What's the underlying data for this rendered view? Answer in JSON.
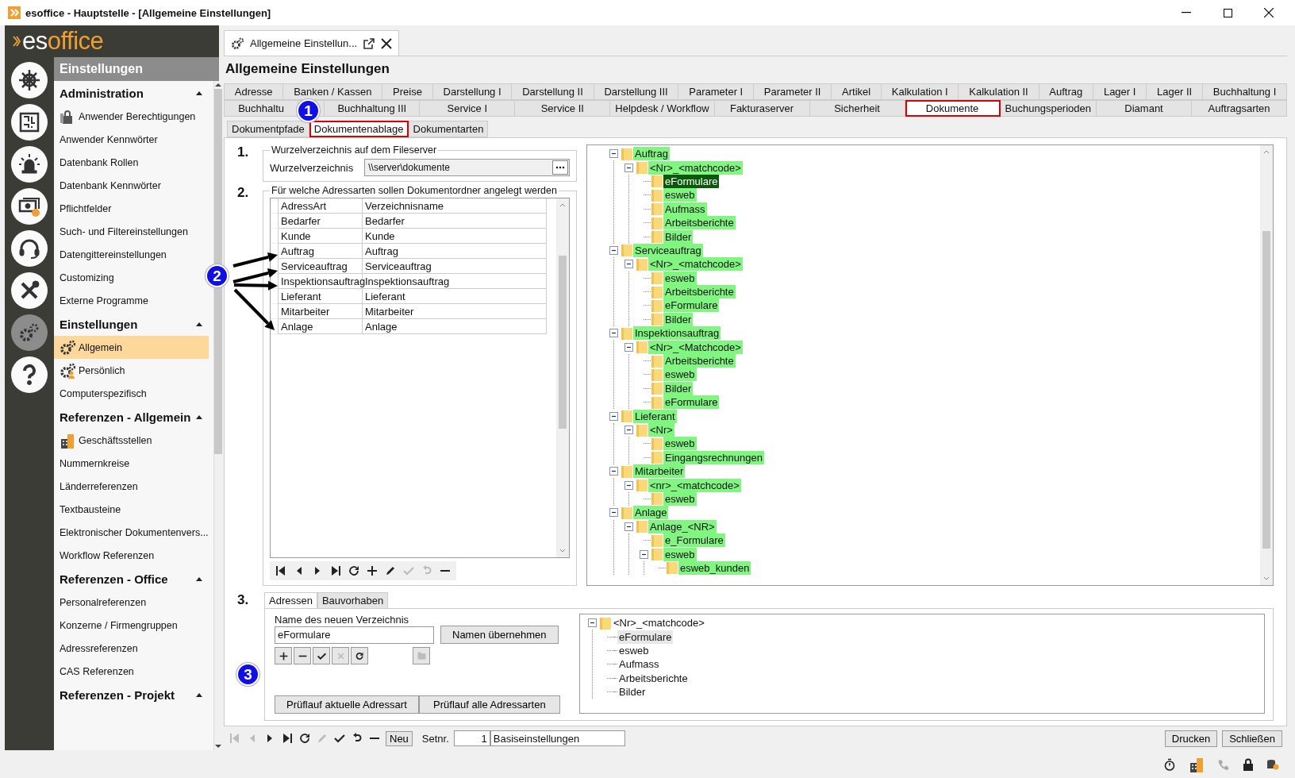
{
  "window": {
    "title": "esoffice - Hauptstelle - [Allgemeine Einstellungen]"
  },
  "logo": {
    "prefix": "es",
    "suffix": "office"
  },
  "rail": [
    {
      "kind": "helm",
      "selected": false
    },
    {
      "kind": "board",
      "selected": false
    },
    {
      "kind": "siren",
      "selected": false
    },
    {
      "kind": "money",
      "selected": false
    },
    {
      "kind": "headset",
      "selected": false
    },
    {
      "kind": "tools",
      "selected": false
    },
    {
      "kind": "gears",
      "selected": true
    },
    {
      "kind": "help",
      "selected": false
    }
  ],
  "sidebar": {
    "title": "Einstellungen",
    "sections": [
      {
        "title": "Administration",
        "expanded": true,
        "items": [
          {
            "label": "Anwender Berechtigungen",
            "kind": "lock",
            "selected": false
          },
          {
            "label": "Anwender Kennwörter",
            "kind": "plain",
            "selected": false
          },
          {
            "label": "Datenbank Rollen",
            "kind": "plain",
            "selected": false
          },
          {
            "label": "Datenbank Kennwörter",
            "kind": "plain",
            "selected": false
          },
          {
            "label": "Pflichtfelder",
            "kind": "plain",
            "selected": false
          },
          {
            "label": "Such- und Filtereinstellungen",
            "kind": "plain",
            "selected": false
          },
          {
            "label": "Datengittereinstellungen",
            "kind": "plain",
            "selected": false
          },
          {
            "label": "Customizing",
            "kind": "plain",
            "selected": false
          },
          {
            "label": "Externe Programme",
            "kind": "plain",
            "selected": false
          }
        ]
      },
      {
        "title": "Einstellungen",
        "expanded": true,
        "items": [
          {
            "label": "Allgemein",
            "kind": "gears",
            "selected": true
          },
          {
            "label": "Persönlich",
            "kind": "gear-person",
            "selected": false
          },
          {
            "label": "Computerspezifisch",
            "kind": "plain",
            "selected": false
          }
        ]
      },
      {
        "title": "Referenzen - Allgemein",
        "expanded": true,
        "items": [
          {
            "label": "Geschäftsstellen",
            "kind": "building",
            "selected": false
          },
          {
            "label": "Nummernkreise",
            "kind": "plain",
            "selected": false
          },
          {
            "label": "Länderreferenzen",
            "kind": "plain",
            "selected": false
          },
          {
            "label": "Textbausteine",
            "kind": "plain",
            "selected": false
          },
          {
            "label": "Elektronischer Dokumentenvers...",
            "kind": "plain",
            "selected": false
          },
          {
            "label": "Workflow Referenzen",
            "kind": "plain",
            "selected": false
          }
        ]
      },
      {
        "title": "Referenzen - Office",
        "expanded": true,
        "items": [
          {
            "label": "Personalreferenzen",
            "kind": "plain",
            "selected": false
          },
          {
            "label": "Konzerne / Firmengruppen",
            "kind": "plain",
            "selected": false
          },
          {
            "label": "Adressreferenzen",
            "kind": "plain",
            "selected": false
          },
          {
            "label": "CAS Referenzen",
            "kind": "plain",
            "selected": false
          }
        ]
      },
      {
        "title": "Referenzen - Projekt",
        "expanded": true
      }
    ]
  },
  "document_tab": {
    "title": "Allgemeine Einstellun..."
  },
  "page_title": "Allgemeine Einstellungen",
  "tab_rows": [
    [
      {
        "label": "Adresse",
        "selected": false,
        "marked": false
      },
      {
        "label": "Banken / Kassen",
        "selected": false,
        "marked": false
      },
      {
        "label": "Preise",
        "selected": false,
        "marked": false
      },
      {
        "label": "Darstellung I",
        "selected": false,
        "marked": false
      },
      {
        "label": "Darstellung II",
        "selected": false,
        "marked": false
      },
      {
        "label": "Darstellung III",
        "selected": false,
        "marked": false
      },
      {
        "label": "Parameter I",
        "selected": false,
        "marked": false
      },
      {
        "label": "Parameter II",
        "selected": false,
        "marked": false
      },
      {
        "label": "Artikel",
        "selected": false,
        "marked": false
      },
      {
        "label": "Kalkulation I",
        "selected": false,
        "marked": false
      },
      {
        "label": "Kalkulation II",
        "selected": false,
        "marked": false
      },
      {
        "label": "Auftrag",
        "selected": false,
        "marked": false
      },
      {
        "label": "Lager I",
        "selected": false,
        "marked": false
      },
      {
        "label": "Lager II",
        "selected": false,
        "marked": false
      },
      {
        "label": "Buchhaltung I",
        "selected": false,
        "marked": false
      }
    ],
    [
      {
        "label": "Buchhaltu",
        "selected": false,
        "marked": false
      },
      {
        "label": "Buchhaltung III",
        "selected": false,
        "marked": false
      },
      {
        "label": "Service I",
        "selected": false,
        "marked": false
      },
      {
        "label": "Service II",
        "selected": false,
        "marked": false
      },
      {
        "label": "Helpdesk / Workflow",
        "selected": false,
        "marked": false
      },
      {
        "label": "Fakturaserver",
        "selected": false,
        "marked": false
      },
      {
        "label": "Sicherheit",
        "selected": false,
        "marked": false
      },
      {
        "label": "Dokumente",
        "selected": true,
        "marked": true
      },
      {
        "label": "Buchungsperioden",
        "selected": false,
        "marked": false
      },
      {
        "label": "Diamant",
        "selected": false,
        "marked": false
      },
      {
        "label": "Auftragsarten",
        "selected": false,
        "marked": false
      }
    ]
  ],
  "subtabs": [
    {
      "label": "Dokumentpfade",
      "selected": false,
      "marked": false
    },
    {
      "label": "Dokumentenablage",
      "selected": true,
      "marked": true
    },
    {
      "label": "Dokumentarten",
      "selected": false,
      "marked": false
    }
  ],
  "root_dir": {
    "number": "1.",
    "legend": "Wurzelverzeichnis auf dem Fileserver",
    "label": "Wurzelverzeichnis",
    "value": "\\\\server\\dokumente"
  },
  "address_types": {
    "number": "2.",
    "legend": "Für welche Adressarten sollen Dokumentordner angelegt werden",
    "columns": [
      "AdressArt",
      "Verzeichnisname"
    ],
    "rows": [
      [
        "Bedarfer",
        "Bedarfer"
      ],
      [
        "Kunde",
        "Kunde"
      ],
      [
        "Auftrag",
        "Auftrag"
      ],
      [
        "Serviceauftrag",
        "Serviceauftrag"
      ],
      [
        "Inspektionsauftrag",
        "Inspektionsauftrag"
      ],
      [
        "Lieferant",
        "Lieferant"
      ],
      [
        "Mitarbeiter",
        "Mitarbeiter"
      ],
      [
        "Anlage",
        "Anlage"
      ]
    ],
    "tools": [
      {
        "kind": "first",
        "disabled": false
      },
      {
        "kind": "prev",
        "disabled": false
      },
      {
        "kind": "next",
        "disabled": false
      },
      {
        "kind": "last",
        "disabled": false
      },
      {
        "kind": "refresh",
        "disabled": false
      },
      {
        "kind": "add",
        "disabled": false
      },
      {
        "kind": "edit",
        "disabled": false
      },
      {
        "kind": "confirm",
        "disabled": true
      },
      {
        "kind": "undo",
        "disabled": true
      },
      {
        "kind": "delete",
        "disabled": false
      }
    ]
  },
  "folder_tree": {
    "highlighted": true,
    "all_folders": true,
    "nodes": [
      {
        "label": "Auftrag",
        "selected": false,
        "expanded": true,
        "children": [
          {
            "label": "<Nr>_<matchcode>",
            "selected": false,
            "expanded": true,
            "children": [
              {
                "label": "eFormulare",
                "selected": true
              },
              {
                "label": "esweb",
                "selected": false
              },
              {
                "label": "Aufmass",
                "selected": false
              },
              {
                "label": "Arbeitsberichte",
                "selected": false
              },
              {
                "label": "Bilder",
                "selected": false
              }
            ]
          }
        ]
      },
      {
        "label": "Serviceauftrag",
        "selected": false,
        "expanded": true,
        "children": [
          {
            "label": "<Nr>_<matchcode>",
            "selected": false,
            "expanded": true,
            "children": [
              {
                "label": "esweb",
                "selected": false
              },
              {
                "label": "Arbeitsberichte",
                "selected": false
              },
              {
                "label": "eFormulare",
                "selected": false
              },
              {
                "label": "Bilder",
                "selected": false
              }
            ]
          }
        ]
      },
      {
        "label": "Inspektionsauftrag",
        "selected": false,
        "expanded": true,
        "children": [
          {
            "label": "<Nr>_<Matchcode>",
            "selected": false,
            "expanded": true,
            "children": [
              {
                "label": "Arbeitsberichte",
                "selected": false
              },
              {
                "label": "esweb",
                "selected": false
              },
              {
                "label": "Bilder",
                "selected": false
              },
              {
                "label": "eFormulare",
                "selected": false
              }
            ]
          }
        ]
      },
      {
        "label": "Lieferant",
        "selected": false,
        "expanded": true,
        "children": [
          {
            "label": "<Nr>",
            "selected": false,
            "expanded": true,
            "children": [
              {
                "label": "esweb",
                "selected": false
              },
              {
                "label": "Eingangsrechnungen",
                "selected": false
              }
            ]
          }
        ]
      },
      {
        "label": "Mitarbeiter",
        "selected": false,
        "expanded": true,
        "children": [
          {
            "label": "<nr>_<matchcode>",
            "selected": false,
            "expanded": true,
            "children": [
              {
                "label": "esweb",
                "selected": false
              }
            ]
          }
        ]
      },
      {
        "label": "Anlage",
        "selected": false,
        "expanded": true,
        "children": [
          {
            "label": "Anlage_<NR>",
            "selected": false,
            "expanded": true,
            "children": [
              {
                "label": "e_Formulare",
                "selected": false
              },
              {
                "label": "esweb",
                "selected": false,
                "expanded": true,
                "children": [
                  {
                    "label": "esweb_kunden",
                    "selected": false
                  }
                ]
              }
            ]
          }
        ]
      }
    ]
  },
  "section_3": {
    "number": "3.",
    "tabs": [
      {
        "label": "Adressen",
        "selected": true
      },
      {
        "label": "Bauvorhaben",
        "selected": false
      }
    ],
    "field_label": "Name des neuen Verzeichnis",
    "field_value": "eFormulare",
    "apply_button": "Namen übernehmen",
    "tools": [
      {
        "kind": "add",
        "disabled": false
      },
      {
        "kind": "delete",
        "disabled": false
      },
      {
        "kind": "confirm",
        "disabled": false
      },
      {
        "kind": "cancel",
        "disabled": true
      },
      {
        "kind": "redo",
        "disabled": false
      }
    ],
    "extra_tool": {
      "kind": "folder",
      "disabled": true
    },
    "buttons": [
      "Prüflauf aktuelle Adressart",
      "Prüflauf alle Adressarten"
    ],
    "tree": {
      "highlighted": false,
      "all_folders": false,
      "nodes": [
        {
          "label": "<Nr>_<matchcode>",
          "selected": false,
          "expanded": true,
          "children": [
            {
              "label": "eFormulare",
              "selected": true
            },
            {
              "label": "esweb",
              "selected": false
            },
            {
              "label": "Aufmass",
              "selected": false
            },
            {
              "label": "Arbeitsberichte",
              "selected": false
            },
            {
              "label": "Bilder",
              "selected": false
            }
          ]
        }
      ]
    }
  },
  "nav_bar": {
    "tools": [
      {
        "kind": "first",
        "disabled": true
      },
      {
        "kind": "prev",
        "disabled": true
      },
      {
        "kind": "next",
        "disabled": false
      },
      {
        "kind": "last",
        "disabled": false
      },
      {
        "kind": "refresh",
        "disabled": false
      },
      {
        "kind": "edit",
        "disabled": true
      },
      {
        "kind": "confirm",
        "disabled": false
      },
      {
        "kind": "undo",
        "disabled": false
      },
      {
        "kind": "delete",
        "disabled": false
      }
    ],
    "new_button": "Neu",
    "set_label": "Setnr.",
    "set_number": "1",
    "set_name": "Basiseinstellungen",
    "buttons": [
      "Drucken",
      "Schließen"
    ]
  },
  "annotations": [
    {
      "label": "1"
    },
    {
      "label": "2"
    },
    {
      "label": "3"
    }
  ]
}
